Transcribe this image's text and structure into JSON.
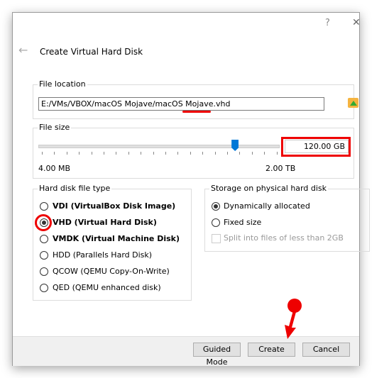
{
  "window": {
    "help": "?",
    "close": "✕"
  },
  "header": {
    "title": "Create Virtual Hard Disk"
  },
  "file_location": {
    "label": "File location",
    "value": "E:/VMs/VBOX/macOS Mojave/macOS Mojave.vhd"
  },
  "file_size": {
    "label": "File size",
    "value": "120.00 GB",
    "min": "4.00 MB",
    "max": "2.00 TB",
    "slider_fraction": 0.82
  },
  "disk_type": {
    "label": "Hard disk file type",
    "options": [
      {
        "label": "VDI (VirtualBox Disk Image)",
        "bold": true,
        "checked": false
      },
      {
        "label": "VHD (Virtual Hard Disk)",
        "bold": true,
        "checked": true
      },
      {
        "label": "VMDK (Virtual Machine Disk)",
        "bold": true,
        "checked": false
      },
      {
        "label": "HDD (Parallels Hard Disk)",
        "bold": false,
        "checked": false
      },
      {
        "label": "QCOW (QEMU Copy-On-Write)",
        "bold": false,
        "checked": false
      },
      {
        "label": "QED (QEMU enhanced disk)",
        "bold": false,
        "checked": false
      }
    ]
  },
  "storage": {
    "label": "Storage on physical hard disk",
    "options": [
      {
        "label": "Dynamically allocated",
        "checked": true
      },
      {
        "label": "Fixed size",
        "checked": false
      }
    ],
    "split": {
      "label": "Split into files of less than 2GB",
      "checked": false,
      "disabled": true
    }
  },
  "buttons": {
    "guided": "Guided Mode",
    "create": "Create",
    "cancel": "Cancel"
  },
  "colors": {
    "annotation": "#ee0000",
    "slider": "#0078d7",
    "footer": "#f0f0f0"
  }
}
